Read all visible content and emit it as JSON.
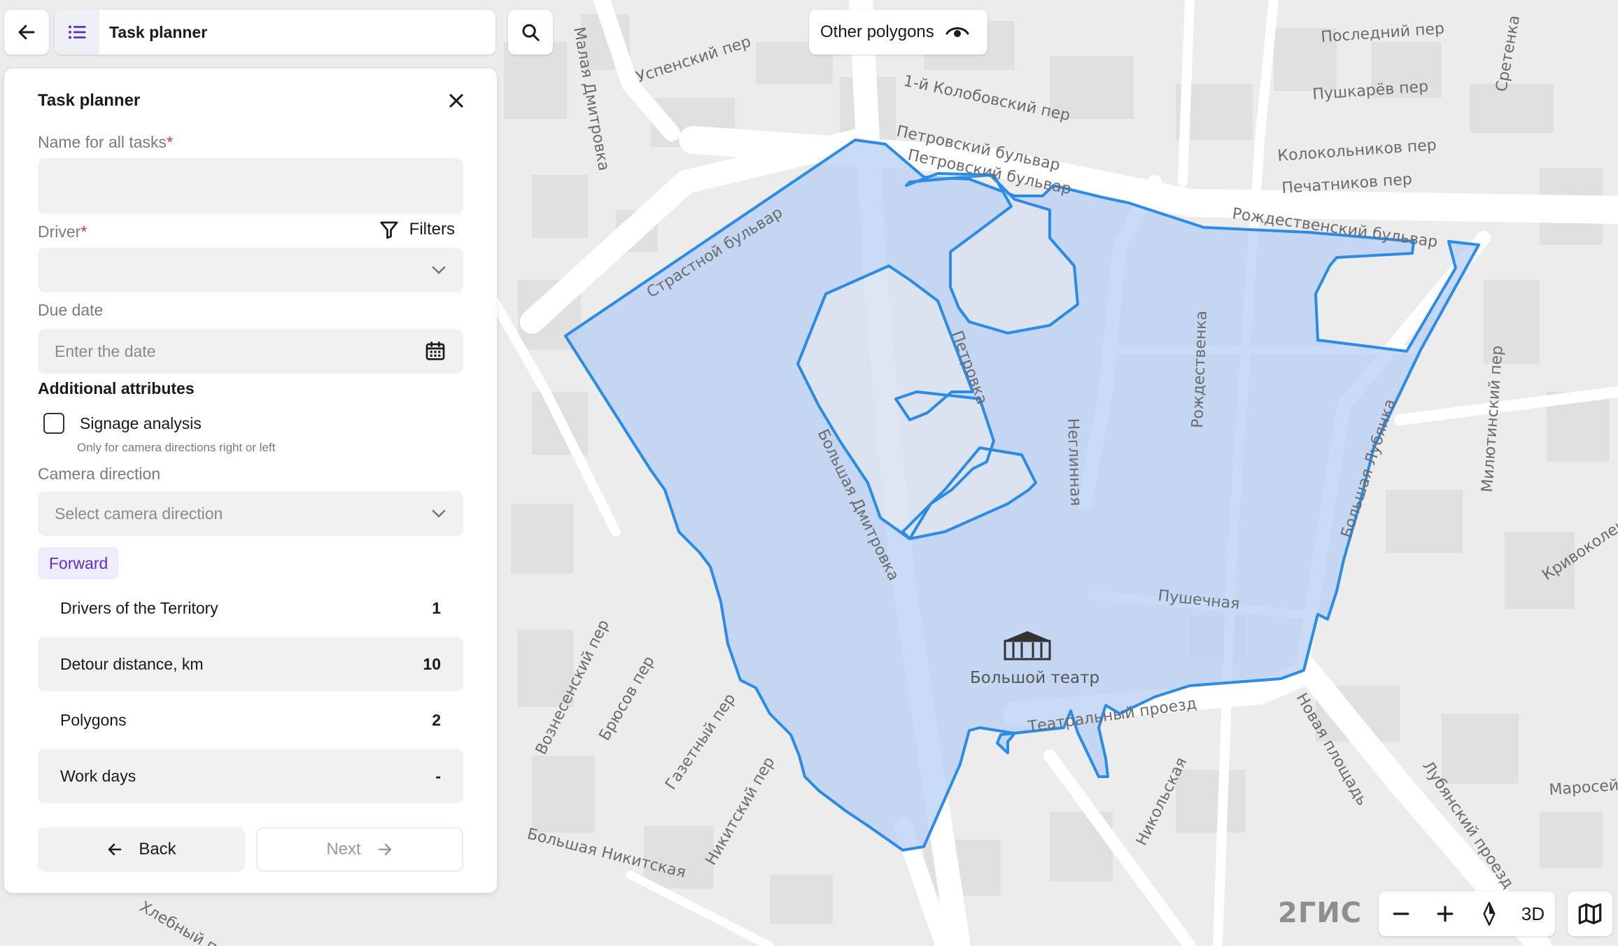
{
  "topbar": {
    "title": "Task planner",
    "other_polygons_label": "Other polygons"
  },
  "panel": {
    "title": "Task planner",
    "name_label": "Name for all tasks",
    "name_value": "",
    "driver_label": "Driver",
    "driver_value": "",
    "filters_label": "Filters",
    "due_date_label": "Due date",
    "due_date_placeholder": "Enter the date",
    "additional_title": "Additional attributes",
    "signage_label": "Signage analysis",
    "signage_hint": "Only for camera directions right or left",
    "signage_checked": false,
    "camera_label": "Camera direction",
    "camera_placeholder": "Select camera direction",
    "camera_chip": "Forward",
    "stats": [
      {
        "label": "Drivers of the Territory",
        "value": "1"
      },
      {
        "label": "Detour distance, km",
        "value": "10"
      },
      {
        "label": "Polygons",
        "value": "2"
      },
      {
        "label": "Work days",
        "value": "-"
      }
    ],
    "back_label": "Back",
    "next_label": "Next"
  },
  "map": {
    "brand": "2ГИС",
    "mode_3d": "3D",
    "theatre_label": "Большой театр",
    "streets": [
      "Успенский пер",
      "Малая Дмитровка",
      "1-й Колобовский пер",
      "Петровский бульвар",
      "Петровский бульвар",
      "Последний пер",
      "Пушкарёв пер",
      "Колокольников пер",
      "Печатников пер",
      "Рождественский бульвар",
      "Страстной бульвар",
      "Петровка",
      "Неглинная",
      "Рождественка",
      "Большая Лубянка",
      "Большая Дмитровка",
      "Пушечная",
      "Театральный проезд",
      "Новая площадь",
      "Лубянский проезд",
      "Милютинский пер",
      "Никольская",
      "Большая Никитская",
      "Никитский пер",
      "Газетный пер",
      "Брюсов пер",
      "Вознесенский пер",
      "Хлебный пер",
      "Маросейка",
      "Кривоколенный",
      "Сретенка"
    ],
    "colors": {
      "polygon_fill": "#b7cff3",
      "polygon_stroke": "#2b8be8"
    }
  }
}
